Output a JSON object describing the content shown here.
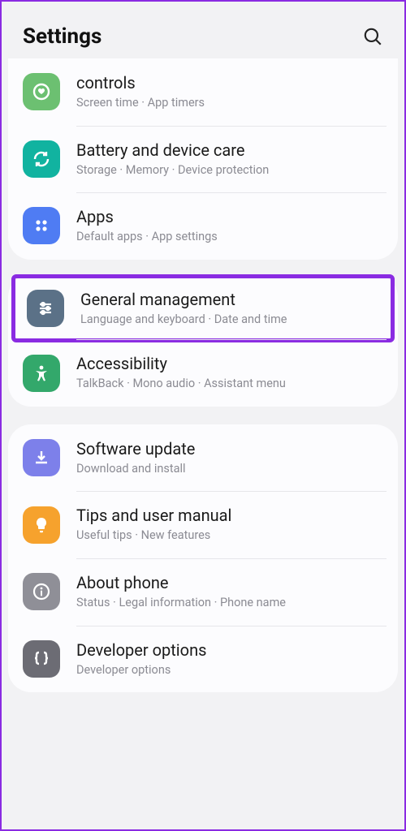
{
  "header": {
    "title": "Settings"
  },
  "groups": [
    {
      "items": [
        {
          "id": "controls",
          "title": "controls",
          "sub": "Screen time  ·  App timers"
        },
        {
          "id": "battery",
          "title": "Battery and device care",
          "sub": "Storage  ·  Memory  ·  Device protection"
        },
        {
          "id": "apps",
          "title": "Apps",
          "sub": "Default apps  ·  App settings"
        }
      ]
    },
    {
      "items": [
        {
          "id": "general",
          "title": "General management",
          "sub": "Language and keyboard  ·  Date and time",
          "highlighted": true
        },
        {
          "id": "accessibility",
          "title": "Accessibility",
          "sub": "TalkBack  ·  Mono audio  ·  Assistant menu"
        }
      ]
    },
    {
      "items": [
        {
          "id": "software",
          "title": "Software update",
          "sub": "Download and install"
        },
        {
          "id": "tips",
          "title": "Tips and user manual",
          "sub": "Useful tips  ·  New features"
        },
        {
          "id": "about",
          "title": "About phone",
          "sub": "Status  ·  Legal information  ·  Phone name"
        },
        {
          "id": "developer",
          "title": "Developer options",
          "sub": "Developer options"
        }
      ]
    }
  ]
}
